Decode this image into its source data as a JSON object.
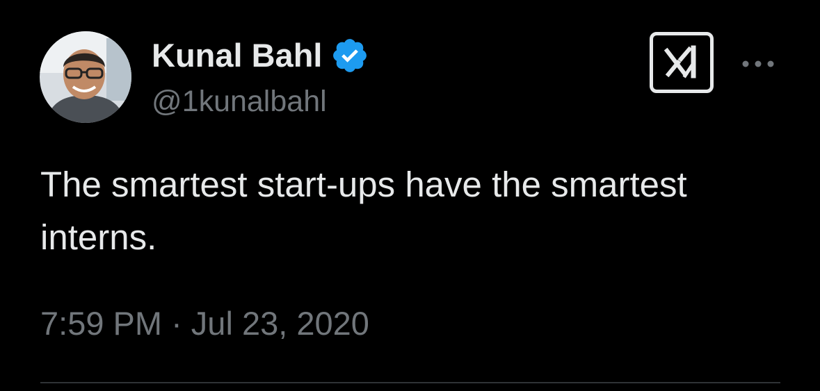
{
  "author": {
    "display_name": "Kunal Bahl",
    "handle": "@1kunalbahl",
    "verified": true,
    "avatar_icon": "profile-photo"
  },
  "brand": {
    "logo_icon": "x-logo",
    "more_icon": "more-horizontal-icon"
  },
  "tweet": {
    "text": "The smartest start-ups have the smartest interns.",
    "timestamp": "7:59 PM · Jul 23, 2020"
  },
  "colors": {
    "background": "#000000",
    "primary_text": "#e7e9ea",
    "secondary_text": "#71767b",
    "verified_badge": "#1d9bf0",
    "divider": "#2f3336"
  }
}
